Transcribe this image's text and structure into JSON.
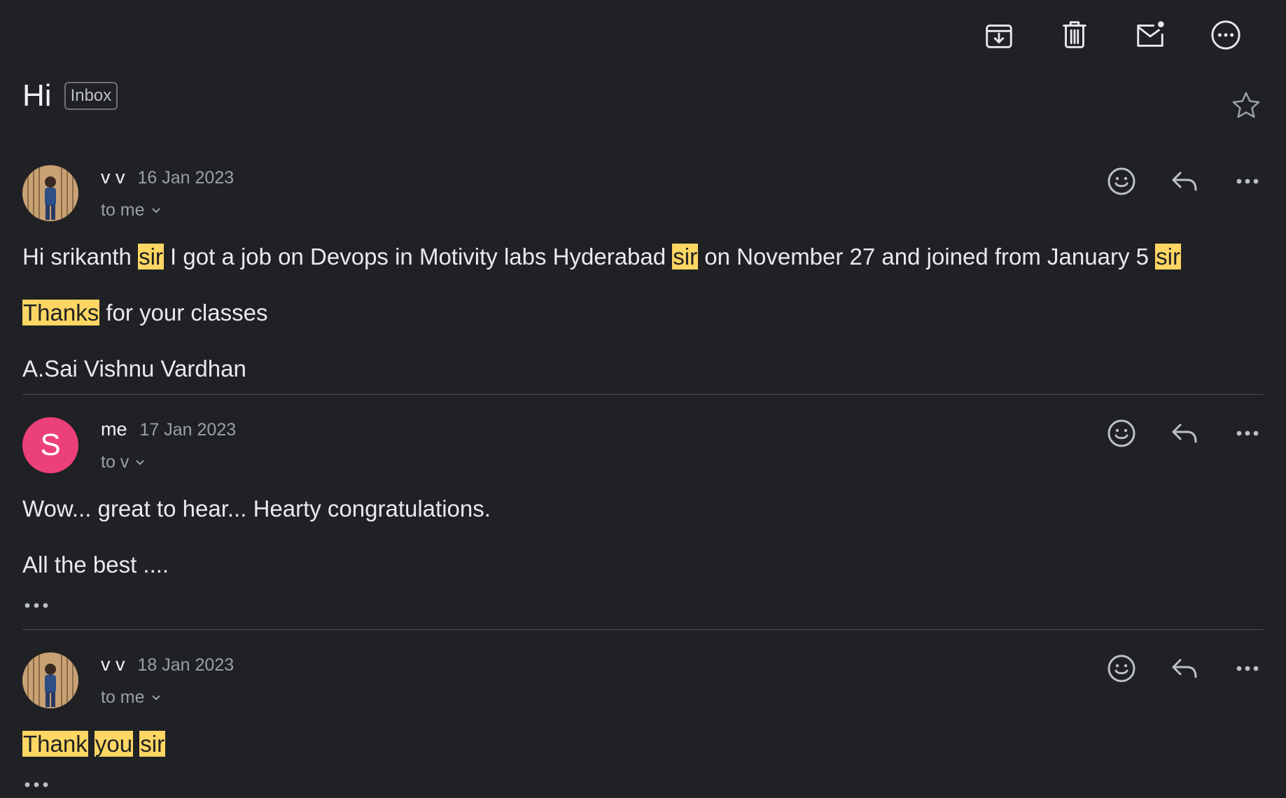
{
  "toolbar": {
    "icons": [
      "archive-icon",
      "delete-icon",
      "mark-unread-icon",
      "more-options-icon"
    ]
  },
  "subject": "Hi",
  "label": "Inbox",
  "messages": [
    {
      "sender": "v v",
      "date": "16 Jan 2023",
      "recipients": "to me",
      "avatar": "photo",
      "lines": [
        [
          "Hi srikanth ",
          {
            "hl": "sir"
          },
          "  I got a job on Devops in Motivity labs Hyderabad ",
          {
            "hl": "sir"
          },
          " on November 27 and joined from January 5 ",
          {
            "hl": "sir"
          }
        ],
        [
          {
            "hl": "Thanks"
          },
          " for your classes"
        ],
        [
          "A.Sai Vishnu Vardhan"
        ]
      ]
    },
    {
      "sender": "me",
      "date": "17 Jan 2023",
      "recipients": "to v",
      "avatar": "letter",
      "avatar_letter": "S",
      "avatar_color": "#ec407a",
      "lines": [
        [
          "Wow... great to hear... Hearty congratulations."
        ],
        [
          "All the best ...."
        ]
      ]
    },
    {
      "sender": "v v",
      "date": "18 Jan 2023",
      "recipients": "to me",
      "avatar": "photo",
      "lines": [
        [
          {
            "hl": "Thank"
          },
          " ",
          {
            "hl": "you"
          },
          " ",
          {
            "hl": "sir"
          }
        ]
      ]
    }
  ],
  "colors": {
    "background": "#202124",
    "highlight": "#fdd663",
    "avatar_pink": "#ec407a"
  }
}
